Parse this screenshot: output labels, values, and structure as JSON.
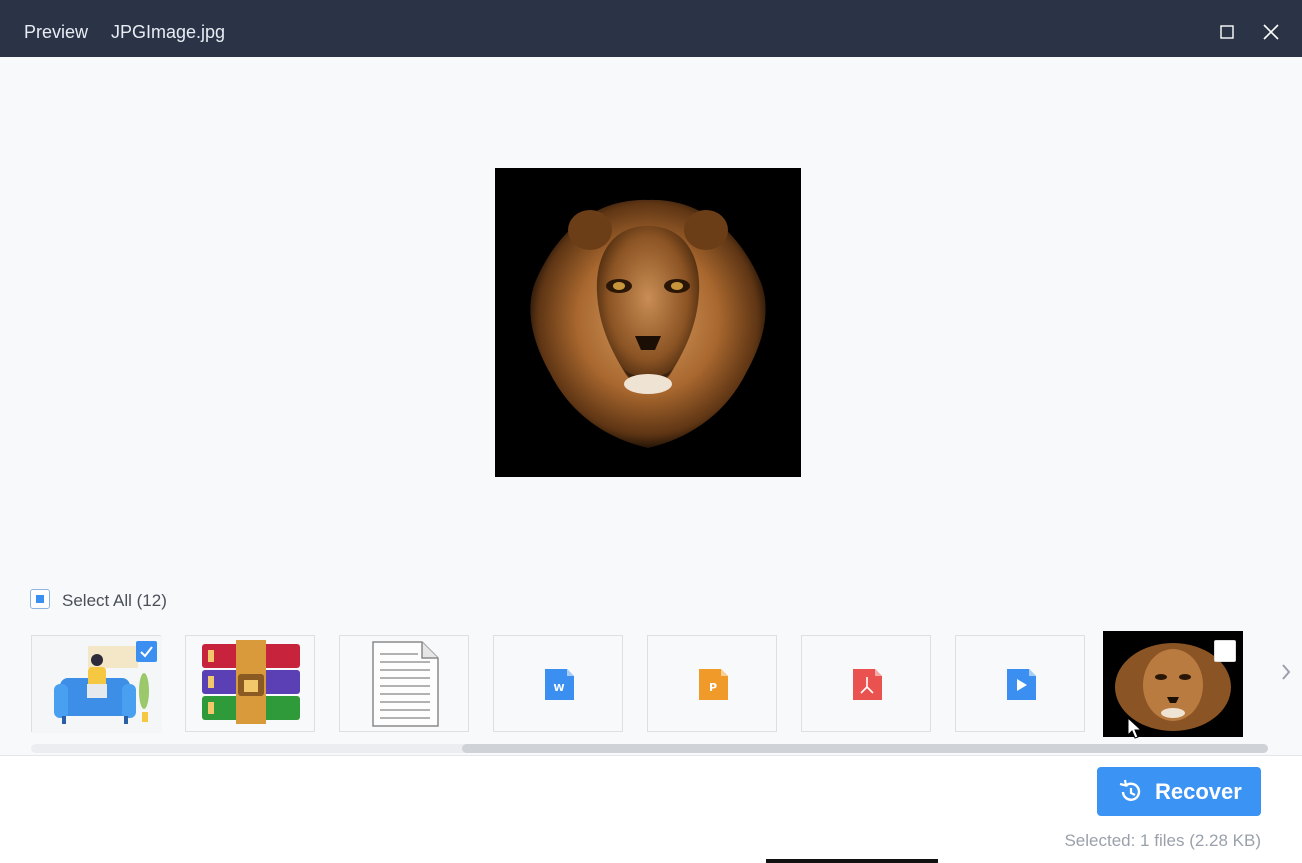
{
  "titlebar": {
    "section": "Preview",
    "filename": "JPGImage.jpg",
    "background": "#2b3447",
    "maximize_icon": "maximize-icon",
    "close_icon": "close-icon"
  },
  "preview": {
    "image": "lion-face-on-black"
  },
  "selection": {
    "select_all_label": "Select All (12)",
    "state": "partial"
  },
  "thumbnails": [
    {
      "kind": "illustration",
      "icon": "person-on-sofa-illustration",
      "checked": true
    },
    {
      "kind": "archive",
      "icon": "winrar-archive-icon",
      "checked": false
    },
    {
      "kind": "text",
      "icon": "text-document-icon",
      "checked": false
    },
    {
      "kind": "word",
      "icon": "word-document-icon",
      "glyph": "W",
      "color": "#3b8ff0",
      "checked": false
    },
    {
      "kind": "powerpoint",
      "icon": "powerpoint-document-icon",
      "glyph": "P",
      "color": "#f09a2a",
      "checked": false
    },
    {
      "kind": "pdf",
      "icon": "pdf-document-icon",
      "color": "#e9524e",
      "checked": false
    },
    {
      "kind": "video",
      "icon": "video-file-icon",
      "color": "#3b8ff0",
      "checked": false
    },
    {
      "kind": "image",
      "icon": "lion-photo-thumbnail",
      "checked": false,
      "active": true
    }
  ],
  "scroll": {
    "position_fraction": 0.35
  },
  "footer": {
    "recover_label": "Recover",
    "recover_icon": "history-icon",
    "status": "Selected: 1 files (2.28 KB)",
    "accent": "#3b93f4"
  }
}
